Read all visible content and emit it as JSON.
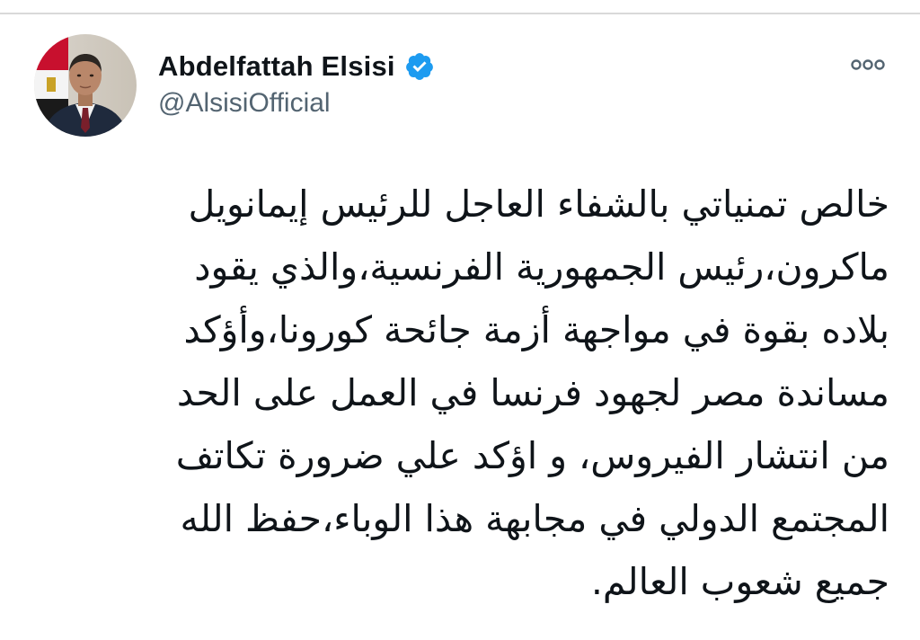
{
  "tweet": {
    "author": {
      "display_name": "Abdelfattah Elsisi",
      "handle": "@AlsisiOfficial",
      "verified": true
    },
    "icons": {
      "avatar": "profile-photo",
      "verified": "verified-badge-icon",
      "more": "more-options-icon"
    },
    "colors": {
      "verified_blue": "#1d9bf0",
      "handle_gray": "#536471",
      "text": "#0f1419"
    },
    "text_lines": [
      "خالص تمنياتي بالشفاء العاجل للرئيس إيمانويل",
      "ماكرون،رئيس الجمهورية الفرنسية،والذي يقود",
      "بلاده بقوة في مواجهة أزمة جائحة كورونا،وأؤكد",
      "مساندة مصر لجهود فرنسا في العمل على الحد",
      "من انتشار الفيروس، و اؤكد علي ضرورة تكاتف",
      "المجتمع الدولي في مجابهة هذا الوباء،حفظ الله",
      "جميع شعوب العالم."
    ]
  }
}
